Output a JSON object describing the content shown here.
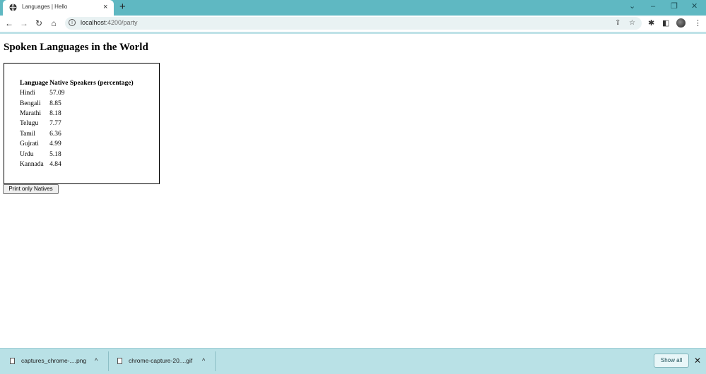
{
  "browser": {
    "tab_title": "Languages | Hello",
    "tab_close": "×",
    "new_tab": "+",
    "window_controls": {
      "chevron": "⌄",
      "minimize": "–",
      "restore": "❐",
      "close": "✕"
    },
    "nav": {
      "back": "←",
      "forward": "→",
      "reload": "↻",
      "home": "⌂"
    },
    "url_host": "localhost",
    "url_path": ":4200/party",
    "omnibox_info": "i",
    "omnibox_share": "⇪",
    "omnibox_star": "☆",
    "icons": [
      "globe-icon",
      "info-icon",
      "share-icon",
      "star-icon",
      "puzzle-icon",
      "side-panel-icon",
      "kebab-menu-icon"
    ],
    "extensions_glyph": "✱",
    "side_panel_glyph": "◧",
    "menu_glyph": "⋮"
  },
  "page": {
    "title": "Spoken Languages in the World",
    "table": {
      "headers": [
        "Language",
        "Native Speakers (percentage)"
      ],
      "rows": [
        [
          "Hindi",
          "57.09"
        ],
        [
          "Bengali",
          "8.85"
        ],
        [
          "Marathi",
          "8.18"
        ],
        [
          "Telugu",
          "7.77"
        ],
        [
          "Tamil",
          "6.36"
        ],
        [
          "Gujrati",
          "4.99"
        ],
        [
          "Urdu",
          "5.18"
        ],
        [
          "Kannada",
          "4.84"
        ]
      ]
    },
    "print_button": "Print only Natives"
  },
  "downloads": {
    "items": [
      {
        "name": "captures_chrome-....png",
        "caret": "^"
      },
      {
        "name": "chrome-capture-20....gif",
        "caret": "^"
      }
    ],
    "show_all": "Show all",
    "close": "✕"
  }
}
